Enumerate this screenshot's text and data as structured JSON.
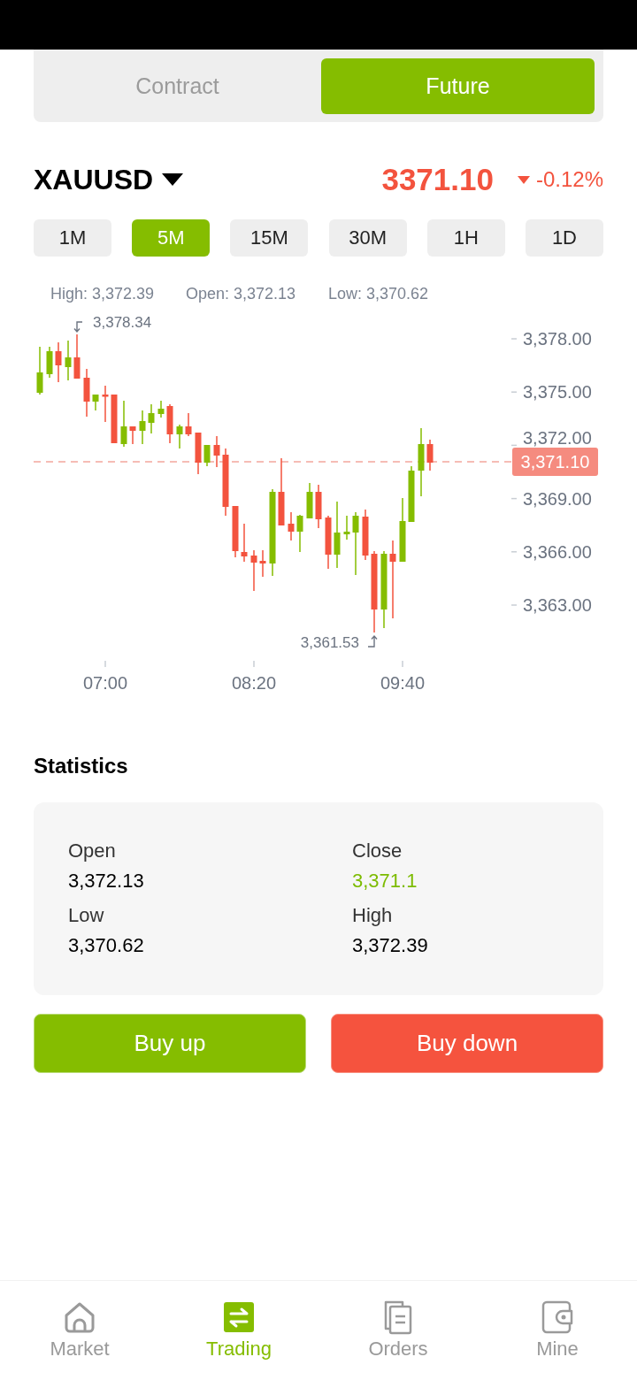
{
  "tabs": [
    {
      "label": "Contract",
      "selected": false
    },
    {
      "label": "Future",
      "selected": true
    }
  ],
  "instrument": {
    "symbol": "XAUUSD",
    "price": "3371.10",
    "change": "-0.12%",
    "falling": true
  },
  "intervals": [
    {
      "label": "1M",
      "selected": false
    },
    {
      "label": "5M",
      "selected": true
    },
    {
      "label": "15M",
      "selected": false
    },
    {
      "label": "30M",
      "selected": false
    },
    {
      "label": "1H",
      "selected": false
    },
    {
      "label": "1D",
      "selected": false
    }
  ],
  "chart": {
    "legend": [
      "High: 3,372.39",
      "Open: 3,372.13",
      "Low: 3,370.62"
    ],
    "max_marker": "3,378.34",
    "min_marker": "3,361.53",
    "y_labels": [
      "3,378.00",
      "3,375.00",
      "3,372.00",
      "3,369.00",
      "3,366.00",
      "3,363.00"
    ],
    "x_labels": [
      "07:00",
      "08:20",
      "09:40"
    ],
    "last_price": "3,371.10"
  },
  "statistics": {
    "title": "Statistics",
    "items": [
      {
        "label": "Open",
        "value": "3,372.13",
        "color": "#000000"
      },
      {
        "label": "Close",
        "value": "3,371.1",
        "color": "#7cbb00"
      },
      {
        "label": "Low",
        "value": "3,370.62",
        "color": "#000000"
      },
      {
        "label": "High",
        "value": "3,372.39",
        "color": "#000000"
      }
    ]
  },
  "actions": [
    {
      "label": "Buy up",
      "kind": "up"
    },
    {
      "label": "Buy down",
      "kind": "down"
    }
  ],
  "nav": [
    {
      "label": "Market",
      "selected": false
    },
    {
      "label": "Trading",
      "selected": true
    },
    {
      "label": "Orders",
      "selected": false
    },
    {
      "label": "Mine",
      "selected": false
    }
  ]
}
